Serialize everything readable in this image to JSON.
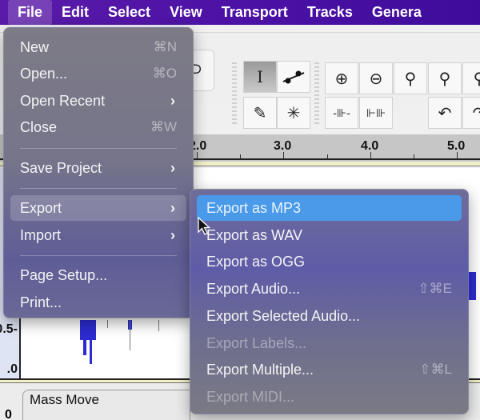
{
  "menubar": {
    "items": [
      {
        "label": "File",
        "active": true
      },
      {
        "label": "Edit"
      },
      {
        "label": "Select"
      },
      {
        "label": "View"
      },
      {
        "label": "Transport"
      },
      {
        "label": "Tracks"
      },
      {
        "label": "Genera"
      }
    ]
  },
  "toolbar": {
    "loop_icon": "loop-icon",
    "tools": [
      {
        "name": "selection-tool",
        "glyph": "I",
        "pressed": true
      },
      {
        "name": "envelope-tool",
        "glyph": "⟋"
      },
      {
        "name": "draw-tool",
        "glyph": "✎"
      },
      {
        "name": "multi-tool",
        "glyph": "✳"
      },
      {
        "name": "zoom-in",
        "glyph": "⊕"
      },
      {
        "name": "zoom-out",
        "glyph": "⊖"
      },
      {
        "name": "fit-selection",
        "glyph": "⚲"
      },
      {
        "name": "fit-project",
        "glyph": "⚲"
      },
      {
        "name": "zoom-toggle",
        "glyph": "⚲"
      },
      {
        "name": "trim-audio",
        "glyph": "⊪"
      },
      {
        "name": "silence-audio",
        "glyph": "⊩"
      },
      {
        "name": "undo",
        "glyph": "↶"
      },
      {
        "name": "redo",
        "glyph": "↷"
      }
    ]
  },
  "ruler": {
    "labels": [
      "2.0",
      "3.0",
      "4.0",
      "5.0"
    ]
  },
  "track": {
    "vruler_labels": [
      "0.5-",
      ".0"
    ],
    "clip_name": "Mass Move",
    "track2_label": "0"
  },
  "file_menu": {
    "items": [
      {
        "label": "New",
        "shortcut": "⌘N"
      },
      {
        "label": "Open...",
        "shortcut": "⌘O"
      },
      {
        "label": "Open Recent",
        "submenu": true
      },
      {
        "label": "Close",
        "shortcut": "⌘W"
      },
      {
        "separator": true
      },
      {
        "label": "Save Project",
        "submenu": true
      },
      {
        "separator": true
      },
      {
        "label": "Export",
        "submenu": true,
        "highlighted": true
      },
      {
        "label": "Import",
        "submenu": true
      },
      {
        "separator": true
      },
      {
        "label": "Page Setup..."
      },
      {
        "label": "Print..."
      }
    ]
  },
  "export_menu": {
    "items": [
      {
        "label": "Export as MP3",
        "highlighted": true
      },
      {
        "label": "Export as WAV"
      },
      {
        "label": "Export as OGG"
      },
      {
        "label": "Export Audio...",
        "shortcut": "⇧⌘E"
      },
      {
        "label": "Export Selected Audio..."
      },
      {
        "label": "Export Labels...",
        "disabled": true
      },
      {
        "label": "Export Multiple...",
        "shortcut": "⇧⌘L"
      },
      {
        "label": "Export MIDI...",
        "disabled": true
      }
    ]
  },
  "colors": {
    "menubar": "#4c11a5",
    "highlight": "#4a9ae9",
    "waveform": "#2c2cd0"
  }
}
